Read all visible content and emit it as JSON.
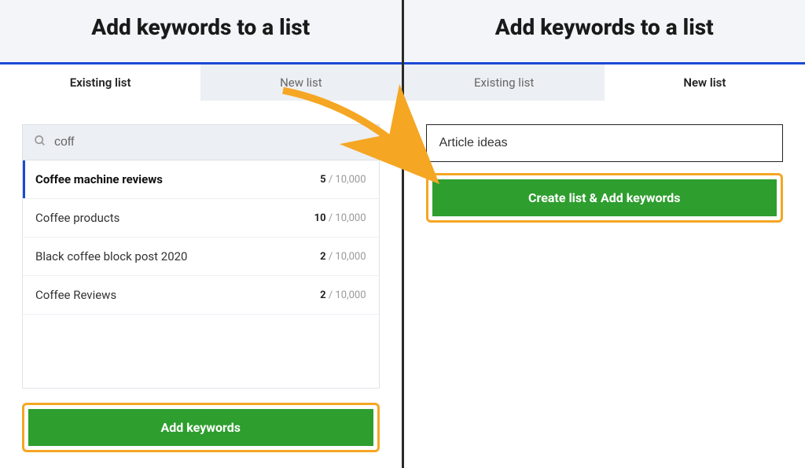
{
  "left": {
    "title": "Add keywords to a list",
    "tab_existing": "Existing list",
    "tab_new": "New list",
    "search_value": "coff",
    "items": [
      {
        "name": "Coffee machine reviews",
        "count": "5",
        "max": " / 10,000"
      },
      {
        "name": "Coffee products",
        "count": "10",
        "max": " / 10,000"
      },
      {
        "name": "Black coffee block post 2020",
        "count": "2",
        "max": " / 10,000"
      },
      {
        "name": "Coffee Reviews",
        "count": "2",
        "max": " / 10,000"
      }
    ],
    "button": "Add keywords"
  },
  "right": {
    "title": "Add keywords to a list",
    "tab_existing": "Existing list",
    "tab_new": "New list",
    "input_value": "Article ideas",
    "button": "Create list & Add keywords"
  }
}
